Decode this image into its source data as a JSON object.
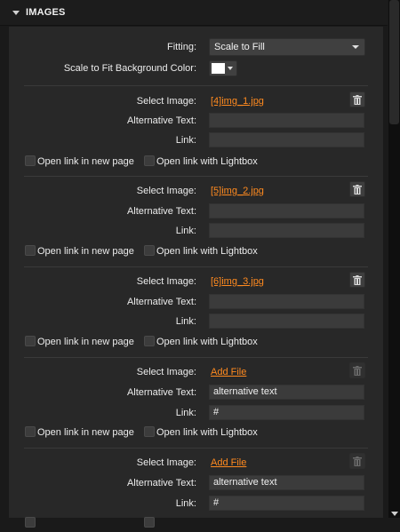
{
  "header": {
    "title": "IMAGES"
  },
  "settings": {
    "fitting_label": "Fitting:",
    "fitting_value": "Scale to Fill",
    "bg_color_label": "Scale to Fit Background Color:",
    "bg_color": "#ffffff"
  },
  "labels": {
    "select_image": "Select Image:",
    "alt_text": "Alternative Text:",
    "link": "Link:",
    "new_page": "Open link in new page",
    "lightbox": "Open link with Lightbox"
  },
  "images": [
    {
      "file": "[4]img_1.jpg",
      "alt": "",
      "link": "",
      "new_page": false,
      "lightbox": false
    },
    {
      "file": "[5]img_2.jpg",
      "alt": "",
      "link": "",
      "new_page": false,
      "lightbox": false
    },
    {
      "file": "[6]img_3.jpg",
      "alt": "",
      "link": "",
      "new_page": false,
      "lightbox": false
    },
    {
      "file": "Add File",
      "alt": "alternative text",
      "link": "#",
      "new_page": false,
      "lightbox": false
    },
    {
      "file": "Add File",
      "alt": "alternative text",
      "link": "#",
      "new_page": false,
      "lightbox": false
    }
  ],
  "colors": {
    "accent": "#ff8a1f",
    "panel": "#282828",
    "field": "#3b3b3b"
  }
}
